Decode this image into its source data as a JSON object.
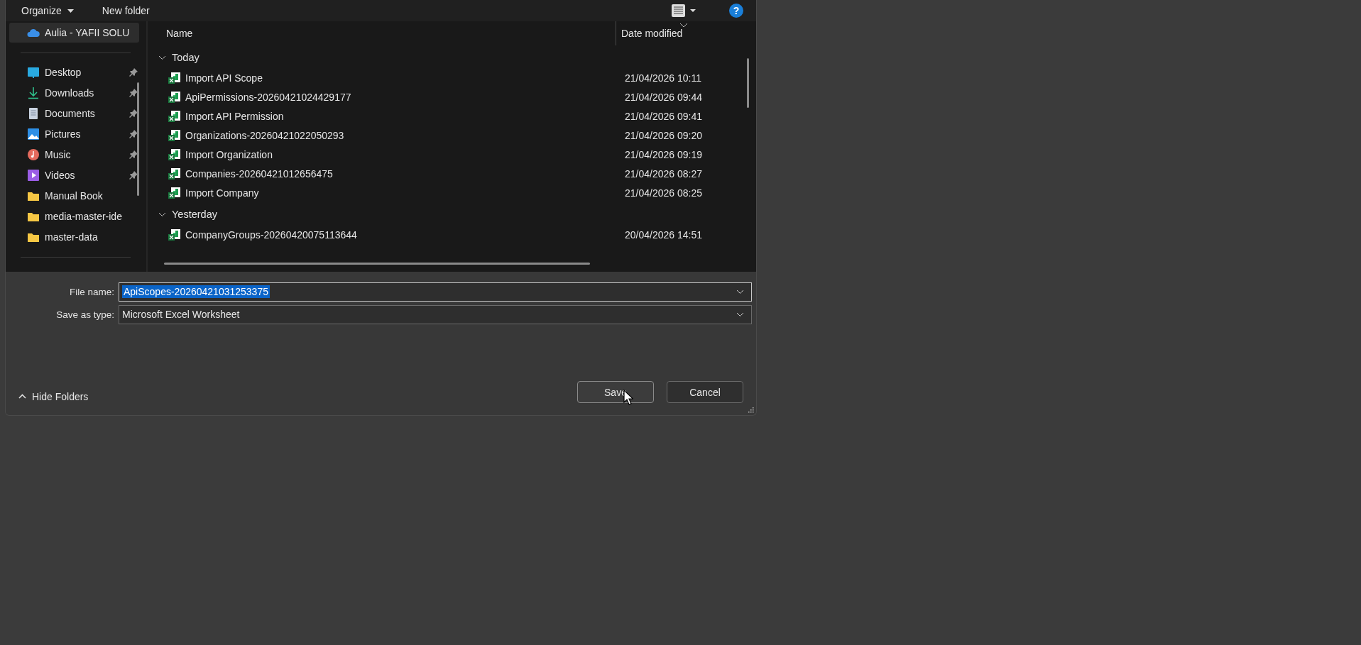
{
  "toolbar": {
    "organize": "Organize",
    "new_folder": "New folder",
    "help": "?"
  },
  "sidebar": {
    "items": [
      {
        "kind": "cloud",
        "label": "Aulia - YAFII SOLU",
        "selected": true,
        "pinned": false
      },
      {
        "kind": "separator"
      },
      {
        "kind": "desktop",
        "label": "Desktop",
        "selected": false,
        "pinned": true
      },
      {
        "kind": "downloads",
        "label": "Downloads",
        "selected": false,
        "pinned": true
      },
      {
        "kind": "documents",
        "label": "Documents",
        "selected": false,
        "pinned": true
      },
      {
        "kind": "pictures",
        "label": "Pictures",
        "selected": false,
        "pinned": true
      },
      {
        "kind": "music",
        "label": "Music",
        "selected": false,
        "pinned": true
      },
      {
        "kind": "videos",
        "label": "Videos",
        "selected": false,
        "pinned": true
      },
      {
        "kind": "folder",
        "label": "Manual Book",
        "selected": false,
        "pinned": false
      },
      {
        "kind": "folder",
        "label": "media-master-ide",
        "selected": false,
        "pinned": false
      },
      {
        "kind": "folder",
        "label": "master-data",
        "selected": false,
        "pinned": false
      },
      {
        "kind": "separator"
      }
    ]
  },
  "table": {
    "columns": [
      "Name",
      "Date modified"
    ],
    "groups": [
      {
        "label": "Today",
        "expanded": true,
        "rows": [
          {
            "name": "Import API Scope",
            "date": "21/04/2026 10:11"
          },
          {
            "name": "ApiPermissions-20260421024429177",
            "date": "21/04/2026 09:44"
          },
          {
            "name": "Import API Permission",
            "date": "21/04/2026 09:41"
          },
          {
            "name": "Organizations-20260421022050293",
            "date": "21/04/2026 09:20"
          },
          {
            "name": "Import Organization",
            "date": "21/04/2026 09:19"
          },
          {
            "name": "Companies-20260421012656475",
            "date": "21/04/2026 08:27"
          },
          {
            "name": "Import Company",
            "date": "21/04/2026 08:25"
          }
        ]
      },
      {
        "label": "Yesterday",
        "expanded": true,
        "rows": [
          {
            "name": "CompanyGroups-20260420075113644",
            "date": "20/04/2026 14:51"
          }
        ]
      }
    ]
  },
  "form": {
    "file_name_label": "File name:",
    "file_name": "ApiScopes-20260421031253375",
    "file_name_highlighted": true,
    "type_label": "Save as type:",
    "type": "Microsoft Excel Worksheet"
  },
  "hide_folders": "Hide Folders",
  "buttons": [
    {
      "label": "Save",
      "hovered": true
    },
    {
      "label": "Cancel",
      "hovered": false
    }
  ]
}
